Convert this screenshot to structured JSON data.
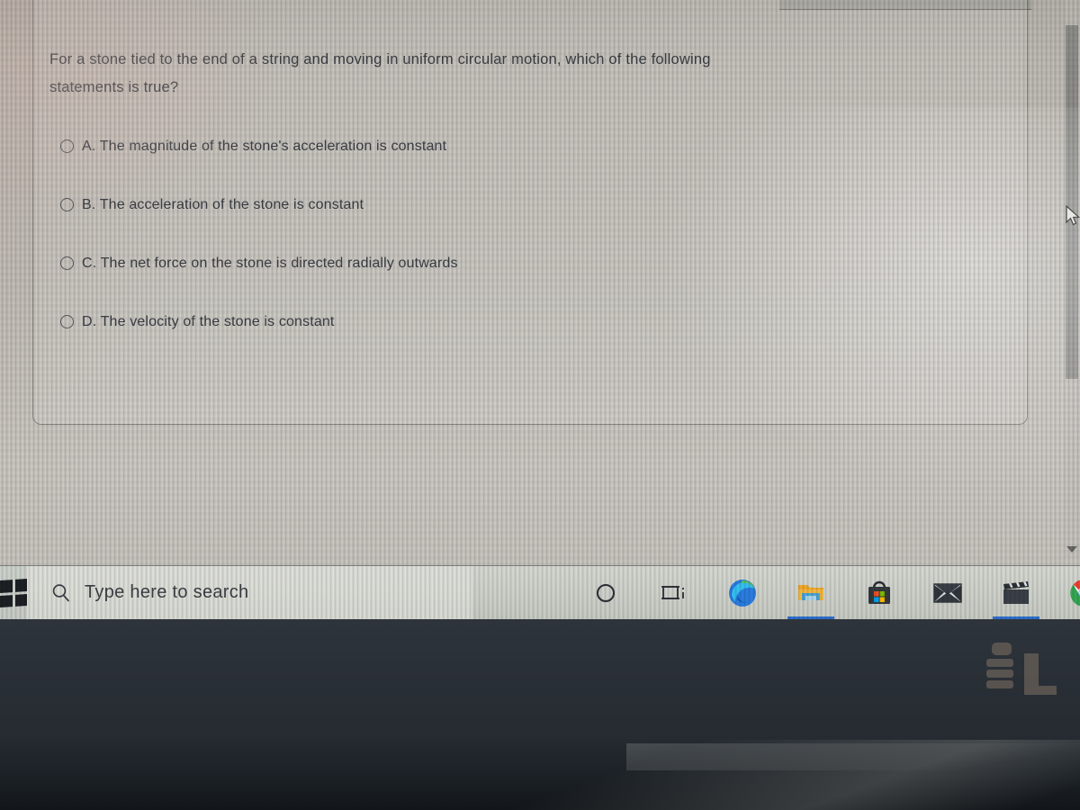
{
  "question": {
    "line1": "For a stone tied to the end of a string and moving in uniform circular motion, which of the following",
    "line2": "statements is true?",
    "options": [
      {
        "letter": "A.",
        "text": "The magnitude of the stone's acceleration is constant",
        "label": "A. The magnitude of the stone's acceleration is constant",
        "selected": false
      },
      {
        "letter": "B.",
        "text": "The acceleration of the stone is constant",
        "label": "B. The acceleration of the stone is constant",
        "selected": false
      },
      {
        "letter": "C.",
        "text": "The net force on the stone is directed radially outwards",
        "label": "C. The net force on the stone is directed radially outwards",
        "selected": false
      },
      {
        "letter": "D.",
        "text": "The velocity of the stone is constant",
        "label": "D. The velocity of the stone is constant",
        "selected": false
      }
    ]
  },
  "scrollbar": {
    "down_arrow_icon": "chevron-down-icon"
  },
  "taskbar": {
    "start_icon": "windows-logo-icon",
    "search_placeholder": "Type here to search",
    "search_icon": "search-icon",
    "items": [
      {
        "name": "cortana-icon",
        "label": "Cortana",
        "active": false
      },
      {
        "name": "task-view-icon",
        "label": "Task View",
        "active": false
      },
      {
        "name": "microsoft-edge-icon",
        "label": "Microsoft Edge",
        "active": false
      },
      {
        "name": "file-explorer-icon",
        "label": "File Explorer",
        "active": true
      },
      {
        "name": "microsoft-store-icon",
        "label": "Microsoft Store",
        "active": false
      },
      {
        "name": "mail-icon",
        "label": "Mail",
        "active": false
      },
      {
        "name": "movies-tv-icon",
        "label": "Movies & TV",
        "active": true
      },
      {
        "name": "google-chrome-icon",
        "label": "Google Chrome",
        "active": false
      }
    ]
  },
  "colors": {
    "taskbar_bg": "#d0d3cc",
    "text": "#3b3f45",
    "card_border": "#54565a",
    "accent_underline": "#2f6fd0",
    "bezel": "#2a3037"
  }
}
